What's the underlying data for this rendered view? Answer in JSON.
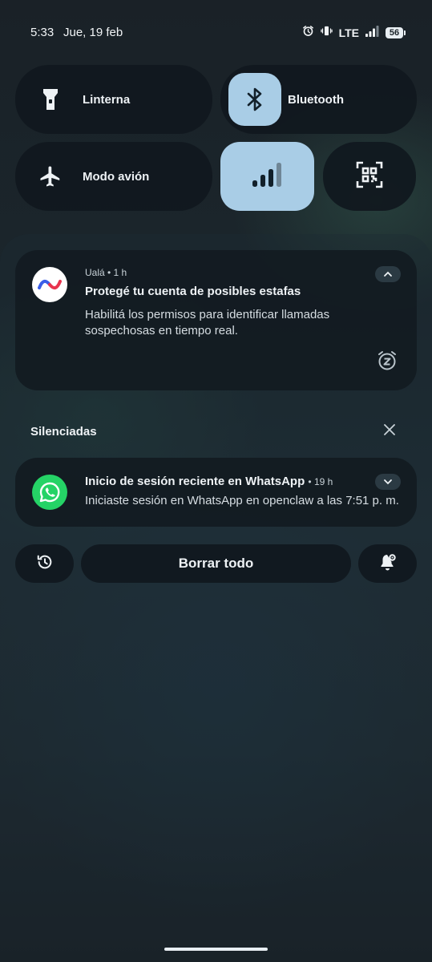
{
  "status_bar": {
    "time": "5:33",
    "date": "Jue, 19 feb",
    "network": "LTE",
    "battery": "56",
    "icons": [
      "alarm-icon",
      "vibrate-icon",
      "signal-icon",
      "battery-icon"
    ]
  },
  "quick_settings": {
    "tiles": [
      {
        "label": "Linterna",
        "icon": "flashlight-icon",
        "active": false
      },
      {
        "label": "Bluetooth",
        "icon": "bluetooth-icon",
        "active": true
      },
      {
        "label": "Modo avión",
        "icon": "airplane-icon",
        "active": false
      },
      {
        "label": "",
        "icon": "mobile-data-icon",
        "active": true
      },
      {
        "label": "",
        "icon": "qr-scanner-icon",
        "active": false
      }
    ],
    "accent_color": "#a9cde6"
  },
  "notifications": {
    "uala": {
      "app": "Ualá",
      "time": "1 h",
      "app_line": "Ualá • 1 h",
      "title": "Protegé tu cuenta de posibles estafas",
      "body": "Habilitá los permisos para identificar llamadas sospechosas en tiempo real.",
      "logo_colors": [
        "#3b5ee8",
        "#e8344e"
      ]
    },
    "silenced_section": {
      "header": "Silenciadas"
    },
    "whatsapp": {
      "title": "Inicio de sesión reciente en WhatsApp",
      "time": "• 19 h",
      "body": "Iniciaste sesión en WhatsApp en openclaw a las 7:51 p. m.",
      "logo_color": "#25d366"
    }
  },
  "actions": {
    "clear_all": "Borrar todo",
    "history_icon": "history-icon",
    "settings_icon": "notification-settings-icon"
  }
}
